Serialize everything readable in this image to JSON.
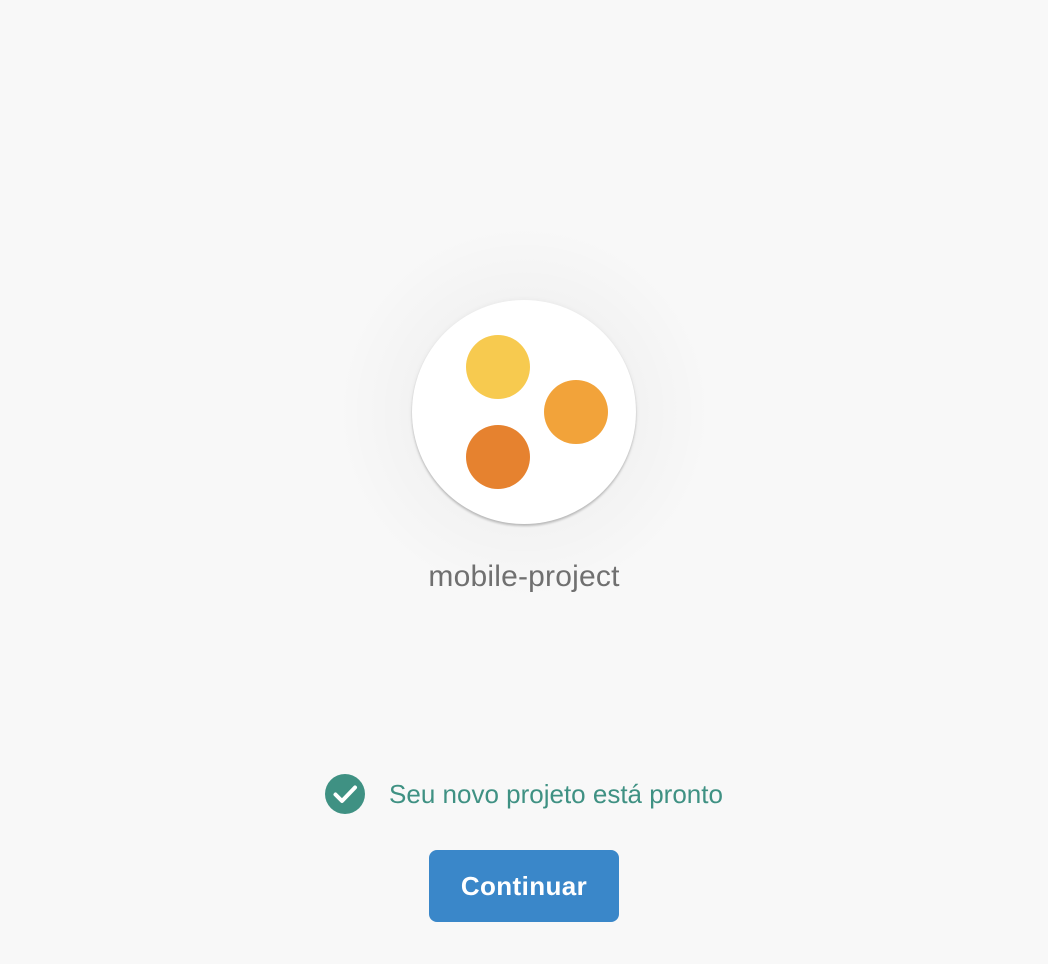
{
  "colors": {
    "background": "#f8f8f8",
    "accent_blue": "#3a87c9",
    "success_teal": "#3f9183",
    "dot_yellow": "#f7ca4f",
    "dot_orange": "#f2a33a",
    "dot_dark_orange": "#e6822f"
  },
  "project": {
    "logo_icon": "three-dots-logo",
    "name": "mobile-project"
  },
  "status": {
    "icon": "check-circle-icon",
    "message": "Seu novo projeto está pronto"
  },
  "actions": {
    "continue_label": "Continuar"
  }
}
